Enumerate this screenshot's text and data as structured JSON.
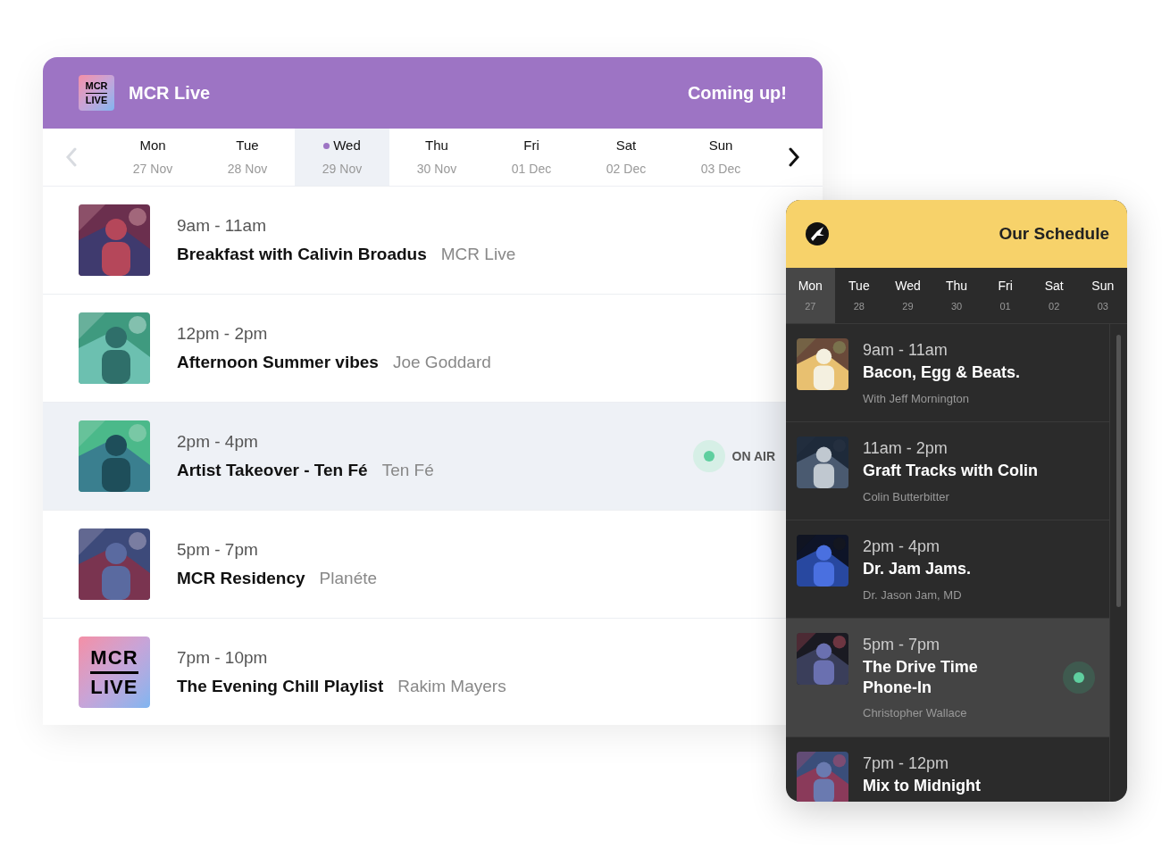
{
  "main_schedule": {
    "header": {
      "logo_lines": [
        "MCR",
        "LIVE"
      ],
      "title": "MCR Live",
      "tagline": "Coming up!"
    },
    "nav": {
      "prev_disabled": true,
      "next_disabled": false
    },
    "days": [
      {
        "label": "Mon",
        "date": "27 Nov",
        "selected": false
      },
      {
        "label": "Tue",
        "date": "28 Nov",
        "selected": false
      },
      {
        "label": "Wed",
        "date": "29 Nov",
        "selected": true
      },
      {
        "label": "Thu",
        "date": "30 Nov",
        "selected": false
      },
      {
        "label": "Fri",
        "date": "01 Dec",
        "selected": false
      },
      {
        "label": "Sat",
        "date": "02 Dec",
        "selected": false
      },
      {
        "label": "Sun",
        "date": "03 Dec",
        "selected": false
      }
    ],
    "shows": [
      {
        "time": "9am - 11am",
        "title": "Breakfast with Calivin Broadus",
        "host": "MCR Live",
        "on_air": false
      },
      {
        "time": "12pm - 2pm",
        "title": "Afternoon Summer vibes",
        "host": "Joe Goddard",
        "on_air": false
      },
      {
        "time": "2pm - 4pm",
        "title": "Artist Takeover - Ten Fé",
        "host": "Ten Fé",
        "on_air": true,
        "on_air_label": "ON AIR"
      },
      {
        "time": "5pm - 7pm",
        "title": "MCR Residency",
        "host": "Planéte",
        "on_air": false
      },
      {
        "thumb": {
          "kind": "logo",
          "lines": [
            "MCR",
            "LIVE"
          ]
        },
        "time": "7pm - 10pm",
        "title": "The Evening Chill Playlist",
        "host": "Rakim Mayers",
        "on_air": false
      }
    ]
  },
  "compact_schedule": {
    "header": {
      "title": "Our Schedule"
    },
    "days": [
      {
        "label": "Mon",
        "date": "27",
        "selected": true
      },
      {
        "label": "Tue",
        "date": "28",
        "selected": false
      },
      {
        "label": "Wed",
        "date": "29",
        "selected": false
      },
      {
        "label": "Thu",
        "date": "30",
        "selected": false
      },
      {
        "label": "Fri",
        "date": "01",
        "selected": false
      },
      {
        "label": "Sat",
        "date": "02",
        "selected": false
      },
      {
        "label": "Sun",
        "date": "03",
        "selected": false
      }
    ],
    "shows": [
      {
        "time": "9am - 11am",
        "title": "Bacon, Egg & Beats.",
        "host": "With Jeff Mornington",
        "on_air": false
      },
      {
        "time": "11am - 2pm",
        "title": "Graft Tracks with Colin",
        "host": "Colin Butterbitter",
        "on_air": false
      },
      {
        "time": "2pm - 4pm",
        "title": "Dr. Jam Jams.",
        "host": "Dr. Jason Jam, MD",
        "on_air": false
      },
      {
        "time": "5pm - 7pm",
        "title": "The Drive Time Phone-In",
        "host": "Christopher Wallace",
        "on_air": true
      },
      {
        "time": "7pm - 12pm",
        "title": "Mix to Midnight",
        "on_air": false
      }
    ]
  }
}
